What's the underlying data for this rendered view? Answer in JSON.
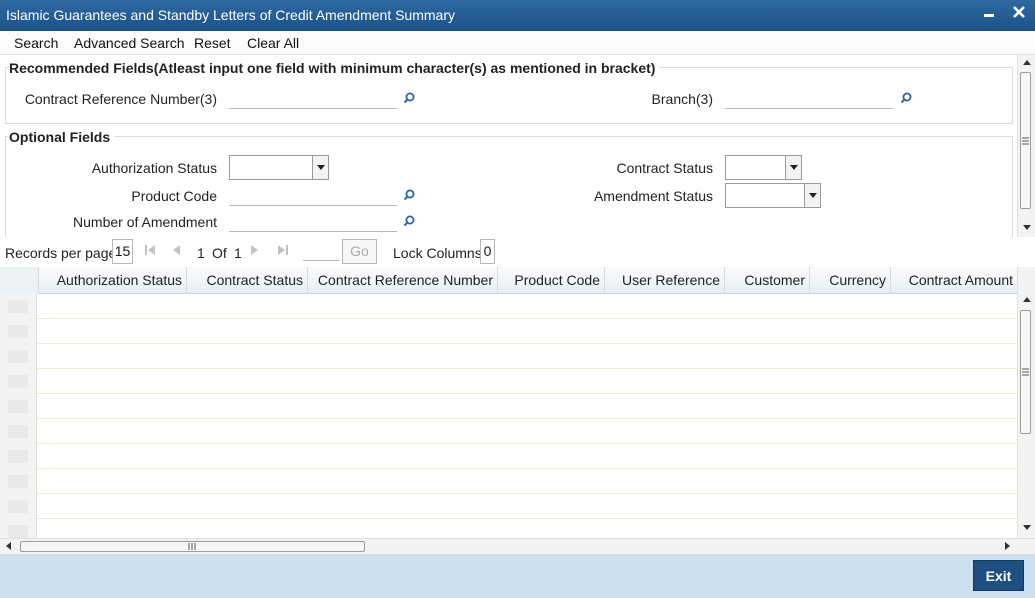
{
  "window": {
    "title": "Islamic Guarantees and Standby Letters of Credit Amendment Summary",
    "minimize_icon": "minimize-icon",
    "close_icon": "close-icon"
  },
  "toolbar": {
    "search": "Search",
    "advanced_search": "Advanced Search",
    "reset": "Reset",
    "clear_all": "Clear All"
  },
  "recommended": {
    "legend": "Recommended Fields(Atleast input one field with minimum character(s) as mentioned in bracket)",
    "contract_ref_label": "Contract Reference Number(3)",
    "contract_ref_value": "",
    "branch_label": "Branch(3)",
    "branch_value": ""
  },
  "optional": {
    "legend": "Optional Fields",
    "auth_status_label": "Authorization Status",
    "auth_status_value": "",
    "contract_status_label": "Contract Status",
    "contract_status_value": "",
    "product_code_label": "Product Code",
    "product_code_value": "",
    "amendment_status_label": "Amendment Status",
    "amendment_status_value": "",
    "num_amendment_label": "Number of Amendment",
    "num_amendment_value": ""
  },
  "pager": {
    "records_label": "Records per page",
    "records_value": "15",
    "current_page": "1",
    "of_label": "Of",
    "total_pages": "1",
    "go_label": "Go",
    "lock_label": "Lock Columns",
    "lock_value": "0"
  },
  "grid": {
    "columns": [
      "Authorization Status",
      "Contract Status",
      "Contract Reference Number",
      "Product Code",
      "User Reference",
      "Customer",
      "Currency",
      "Contract Amount"
    ],
    "row_count": 10
  },
  "footer": {
    "exit": "Exit"
  },
  "colors": {
    "title_bar": "#1c5187",
    "footer": "#cde0f0",
    "exit_button": "#1e4f80"
  }
}
